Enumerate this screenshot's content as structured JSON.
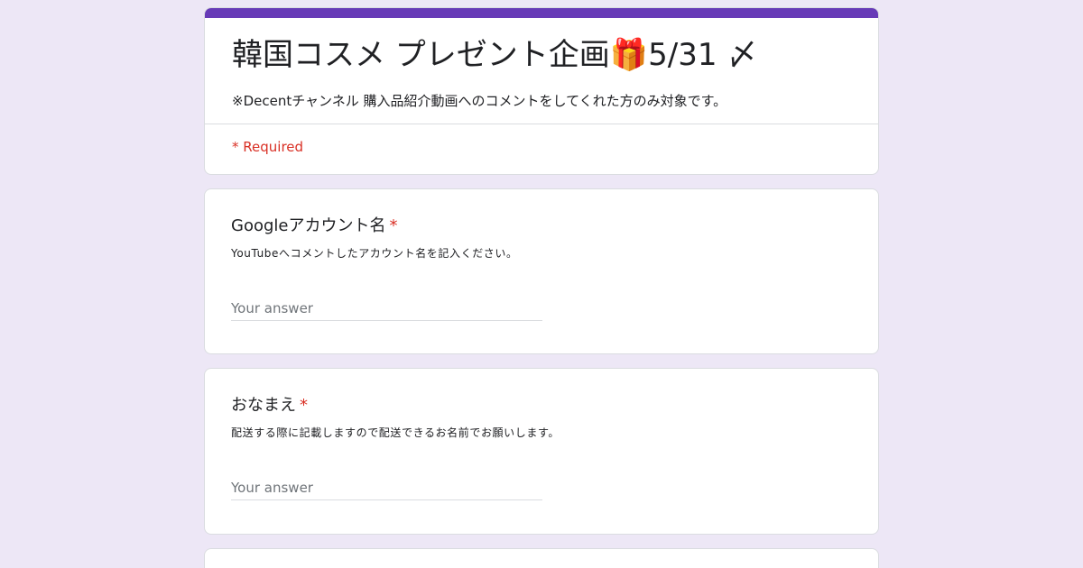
{
  "form": {
    "title": "韓国コスメ プレゼント企画🎁5/31 〆",
    "description": "※Decentチャンネル 購入品紹介動画へのコメントをしてくれた方のみ対象です。",
    "required_note": "* Required",
    "accent_color": "#673ab7",
    "background_color": "#ede7f6"
  },
  "questions": [
    {
      "title": "Googleアカウント名",
      "required_mark": "*",
      "help": "YouTubeへコメントしたアカウント名を記入ください。",
      "placeholder": "Your answer",
      "value": ""
    },
    {
      "title": "おなまえ",
      "required_mark": "*",
      "help": "配送する際に記載しますので配送できるお名前でお願いします。",
      "placeholder": "Your answer",
      "value": ""
    }
  ]
}
